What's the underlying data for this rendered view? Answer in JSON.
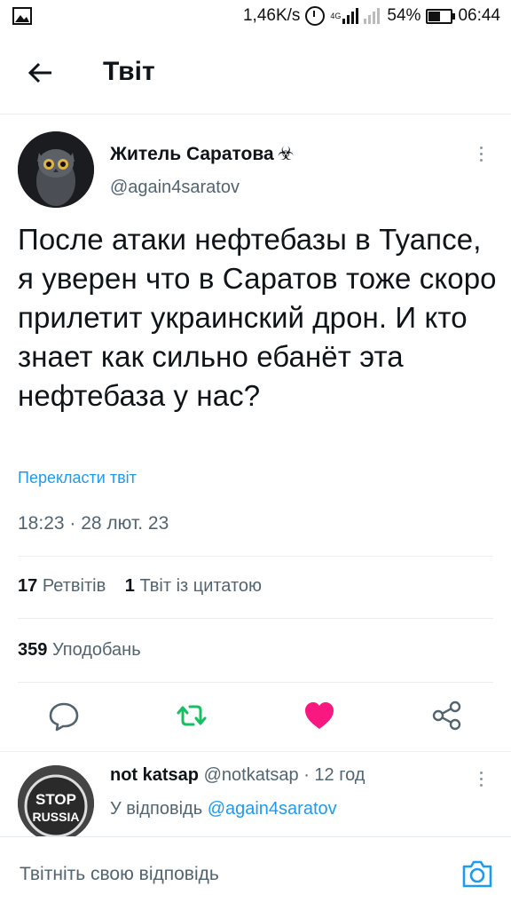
{
  "status_bar": {
    "network_speed": "1,46K/s",
    "network_type": "4G",
    "battery": "54%",
    "time": "06:44"
  },
  "header": {
    "title": "Твіт"
  },
  "tweet": {
    "author_name": "Житель Саратова",
    "author_badge": "☣",
    "author_handle": "@again4saratov",
    "text": "После атаки нефтебазы в Туапсе, я уверен что в Саратов тоже скоро прилетит украинский дрон. И кто знает как сильно ебанёт эта нефтебаза у нас?",
    "translate_label": "Перекласти твіт",
    "timestamp": "18:23 · 28 лют. 23",
    "retweets_count": "17",
    "retweets_label": "Ретвітів",
    "quotes_count": "1",
    "quotes_label": "Твіт із цитатою",
    "likes_count": "359",
    "likes_label": "Уподобань",
    "actions": [
      {
        "icon": "reply-icon"
      },
      {
        "icon": "retweet-icon",
        "color": "#17bf63"
      },
      {
        "icon": "heart-icon",
        "color": "#f91880"
      },
      {
        "icon": "share-icon"
      }
    ]
  },
  "reply": {
    "author_name": "not katsap",
    "author_handle": "@notkatsap",
    "separator": "·",
    "time": "12 год",
    "reply_to_prefix": "У відповідь",
    "reply_to_handle": "@again4saratov",
    "avatar_text": "STOP RUSSIA"
  },
  "composer": {
    "placeholder": "Твітніть свою відповідь"
  },
  "colors": {
    "accent": "#1d9bf0",
    "retweet": "#17bf63",
    "like": "#f91880",
    "muted": "#536471"
  }
}
